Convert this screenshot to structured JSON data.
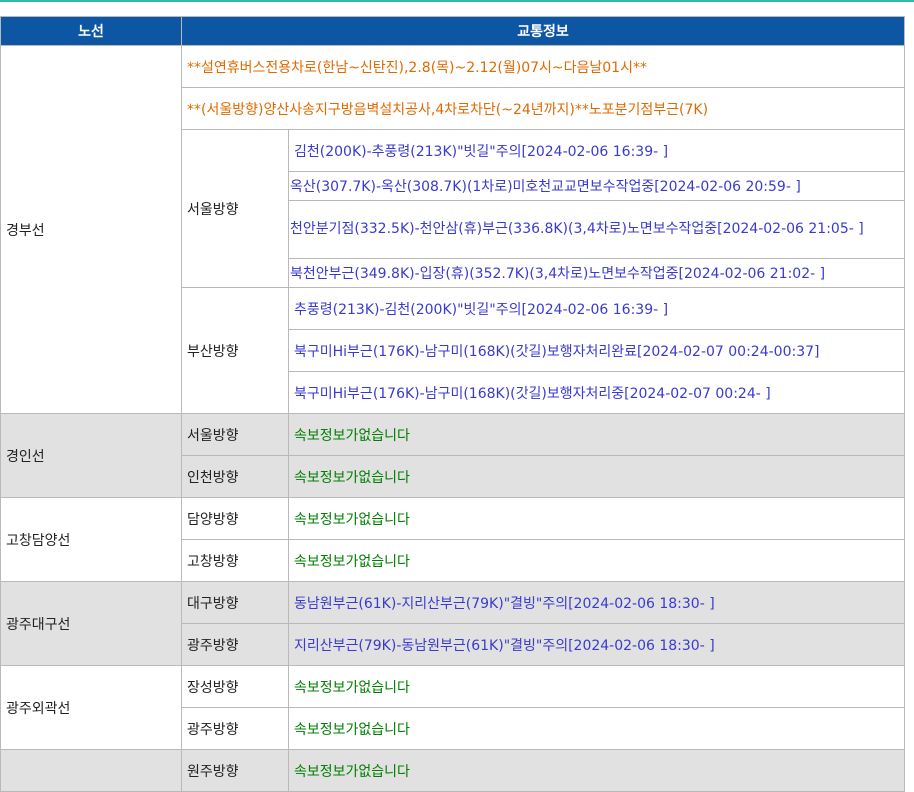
{
  "colors": {
    "header_bg": "#0d56a4",
    "notice": "#e06a00",
    "info": "#3a3ad0",
    "none": "#008000",
    "alt_row": "#e1e1e1",
    "top_accent": "#2eb8b0"
  },
  "header": {
    "route_col": "노선",
    "info_col": "교통정보"
  },
  "gyeongbu": {
    "name": "경부선",
    "notice1": "**설연휴버스전용차로(한남~신탄진),2.8(목)~2.12(월)07시~다음날01시**",
    "notice2": "**(서울방향)양산사송지구방음벽설치공사,4차로차단(~24년까지)**노포분기점부근(7K)",
    "seoul": {
      "label": "서울방향",
      "items": [
        "김천(200K)-추풍령(213K)\"빗길\"주의[2024-02-06 16:39- ]",
        "옥산(307.7K)-옥산(308.7K)(1차로)미호천교교면보수작업중[2024-02-06 20:59- ]",
        "천안분기점(332.5K)-천안삼(휴)부근(336.8K)(3,4차로)노면보수작업중[2024-02-06 21:05- ]",
        "북천안부근(349.8K)-입장(휴)(352.7K)(3,4차로)노면보수작업중[2024-02-06 21:02- ]"
      ]
    },
    "busan": {
      "label": "부산방향",
      "items": [
        "추풍령(213K)-김천(200K)\"빗길\"주의[2024-02-06 16:39- ]",
        "북구미Hi부근(176K)-남구미(168K)(갓길)보행자처리완료[2024-02-07 00:24-00:37]",
        "북구미Hi부근(176K)-남구미(168K)(갓길)보행자처리중[2024-02-07 00:24- ]"
      ]
    }
  },
  "gyeongin": {
    "name": "경인선",
    "d1": "서울방향",
    "d2": "인천방향",
    "i1": "속보정보가없습니다",
    "i2": "속보정보가없습니다"
  },
  "gochang": {
    "name": "고창담양선",
    "d1": "담양방향",
    "d2": "고창방향",
    "i1": "속보정보가없습니다",
    "i2": "속보정보가없습니다"
  },
  "gwangjudaegu": {
    "name": "광주대구선",
    "d1": "대구방향",
    "d2": "광주방향",
    "i1": "동남원부근(61K)-지리산부근(79K)\"결빙\"주의[2024-02-06 18:30- ]",
    "i2": "지리산부근(79K)-동남원부근(61K)\"결빙\"주의[2024-02-06 18:30- ]"
  },
  "gwangjuring": {
    "name": "광주외곽선",
    "d1": "장성방향",
    "d2": "광주방향",
    "i1": "속보정보가없습니다",
    "i2": "속보정보가없습니다"
  },
  "last": {
    "d1": "원주방향",
    "i1": "속보정보가없습니다"
  }
}
